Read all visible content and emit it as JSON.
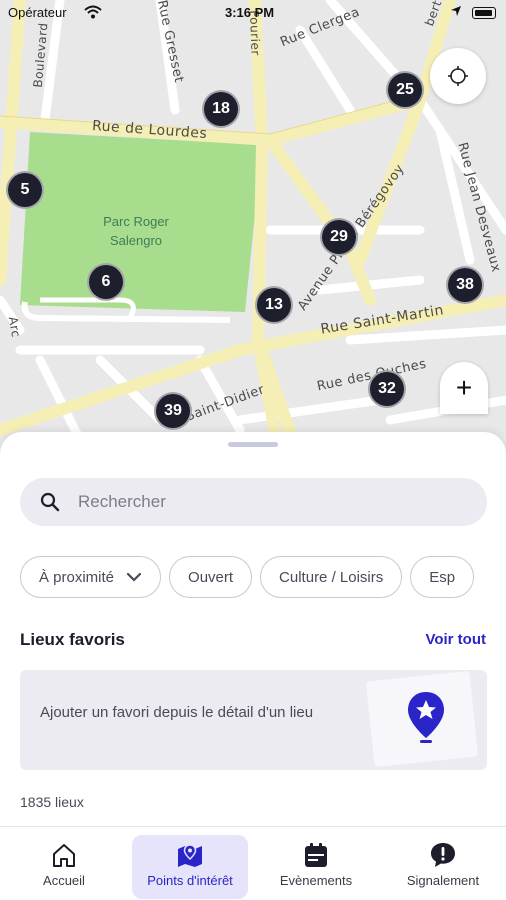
{
  "status_bar": {
    "carrier": "Opérateur",
    "time": "3:16 PM"
  },
  "map": {
    "park_name": "Parc Roger Salengro",
    "roads": {
      "lourdes": "Rue de Lourdes",
      "saint_martin": "Rue Saint-Martin",
      "ouches": "Rue des Ouches",
      "jean_desveaux": "Rue Jean Desveaux",
      "boulevard": "Boulevard",
      "gresset": "Rue Gresset",
      "clergeau": "Rue Clergea",
      "beregovoy": "Avenue Pierre Bérégovoy",
      "saint_didier": "Saint-Didier",
      "fourier": "Fourier",
      "albert": "bert",
      "arc": "Arc"
    },
    "clusters": [
      "18",
      "25",
      "5",
      "29",
      "38",
      "6",
      "13",
      "32",
      "39"
    ],
    "zoom_in_label": "+"
  },
  "sheet": {
    "search_placeholder": "Rechercher",
    "filters": [
      "À proximité",
      "Ouvert",
      "Culture / Loisirs",
      "Esp"
    ],
    "favorites_title": "Lieux favoris",
    "see_all": "Voir tout",
    "favorites_empty": "Ajouter un favori depuis le détail d'un lieu",
    "places_count": "1835 lieux"
  },
  "tabs": [
    {
      "label": "Accueil",
      "icon": "home-icon"
    },
    {
      "label": "Points d'intérêt",
      "icon": "map-icon",
      "active": true
    },
    {
      "label": "Evènements",
      "icon": "calendar-icon"
    },
    {
      "label": "Signalement",
      "icon": "alert-icon"
    }
  ],
  "colors": {
    "accent": "#2a25c9",
    "cluster": "#1d1f2c",
    "park": "#a8dd8e",
    "road": "#f5efb5"
  }
}
